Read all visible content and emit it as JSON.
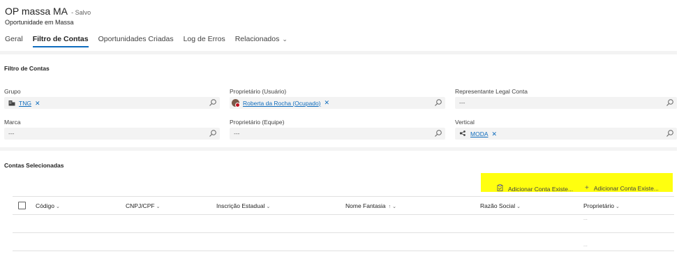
{
  "header": {
    "title": "OP massa MA",
    "saved_status": "- Salvo",
    "subtitle": "Oportunidade em Massa"
  },
  "tabs": [
    {
      "label": "Geral"
    },
    {
      "label": "Filtro de Contas",
      "active": true
    },
    {
      "label": "Oportunidades Criadas"
    },
    {
      "label": "Log de Erros"
    },
    {
      "label": "Relacionados"
    }
  ],
  "filter_section": {
    "title": "Filtro de Contas",
    "fields": {
      "grupo": {
        "label": "Grupo",
        "value": "TNG"
      },
      "proprietario_usuario": {
        "label": "Proprietário (Usuário)",
        "value": "Roberta da Rocha (Ocupado)"
      },
      "representante": {
        "label": "Representante Legal Conta",
        "value": "---"
      },
      "marca": {
        "label": "Marca",
        "value": "---"
      },
      "proprietario_equipe": {
        "label": "Proprietário (Equipe)",
        "value": "---"
      },
      "vertical": {
        "label": "Vertical",
        "value": "MODA"
      }
    }
  },
  "accounts_section": {
    "title": "Contas Selecionadas",
    "commands": [
      {
        "label": "Adicionar Conta Existe...",
        "icon": "clipboard-icon"
      },
      {
        "label": "Adicionar Conta Existe...",
        "icon": "plus-icon"
      }
    ],
    "columns": [
      "Código",
      "CNPJ/CPF",
      "Inscrição Estadual",
      "Nome Fantasia",
      "Razão Social",
      "Proprietário"
    ],
    "sort_column": "Nome Fantasia",
    "rows": [
      {
        "proprietario": "..."
      },
      {
        "proprietario": "..."
      }
    ]
  },
  "colors": {
    "accent": "#0f6cbd",
    "highlight": "#ffff0f",
    "field_bg": "#f3f3f3"
  }
}
